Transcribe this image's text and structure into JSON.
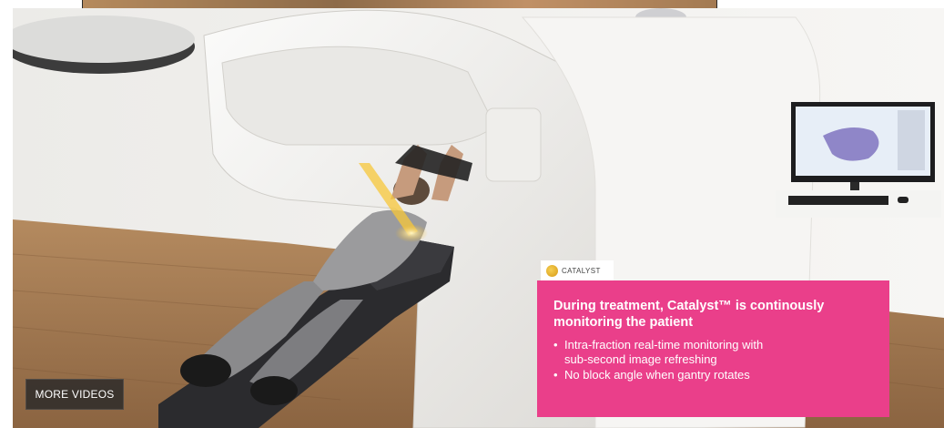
{
  "player": {
    "more_videos_label": "MORE VIDEOS"
  },
  "overlay": {
    "brand": "CATALYST",
    "title_line1": "During treatment, Catalyst™ is continously",
    "title_line2": "monitoring the patient",
    "bullets": [
      "Intra-fraction real-time monitoring with",
      "sub-second image refreshing",
      "No block angle when gantry rotates"
    ],
    "accent_color": "#ea3f8a",
    "logo_color": "#e3a92a"
  },
  "scene": {
    "subject": "patient-on-radiotherapy-couch",
    "icons": [
      "catalyst-logo-icon"
    ]
  }
}
